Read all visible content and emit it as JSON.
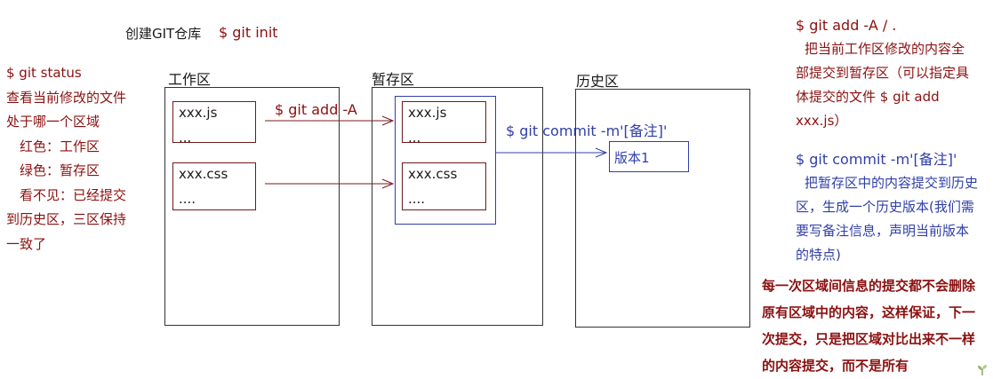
{
  "header": {
    "create_label": "创建GIT仓库",
    "init_cmd": "$ git init"
  },
  "status_note": {
    "command": "$ git status",
    "lines": [
      "查看当前修改的文件",
      "处于哪一个区域",
      "红色：工作区",
      "绿色：暂存区",
      "看不见：已经提交",
      "到历史区，三区保持",
      "一致了"
    ]
  },
  "zones": {
    "working": {
      "label": "工作区",
      "files": [
        {
          "name": "xxx.js",
          "more": "..."
        },
        {
          "name": "xxx.css",
          "more": "...."
        }
      ]
    },
    "staging": {
      "label": "暂存区",
      "files": [
        {
          "name": "xxx.js",
          "more": "..."
        },
        {
          "name": "xxx.css",
          "more": "...."
        }
      ]
    },
    "history": {
      "label": "历史区",
      "version": "版本1"
    }
  },
  "arrows": {
    "add_label": "$ git add -A",
    "commit_label": "$ git commit -m'[备注]'"
  },
  "right_notes": {
    "add_cmd": "$ git add -A / .",
    "add_desc": [
      "把当前工作区修改的内容全",
      "部提交到暂存区（可以指定具",
      "体提交的文件 $ git add",
      "xxx.js）"
    ],
    "commit_cmd": "$ git commit -m'[备注]'",
    "commit_desc": [
      "把暂存区中的内容提交到历史",
      "区，生成一个历史版本(我们需",
      "要写备注信息，声明当前版本",
      "的特点)"
    ],
    "bold_note": [
      "每一次区域间信息的提交都不会删除",
      "原有区域中的内容，这样保证，下一",
      "次提交，只是把区域对比出来不一样",
      "的内容提交，而不是所有"
    ]
  },
  "colors": {
    "dark_red": "#8b1010",
    "blue": "#2f3fa8",
    "border": "#333333"
  },
  "icons": [
    "sprout-icon"
  ]
}
